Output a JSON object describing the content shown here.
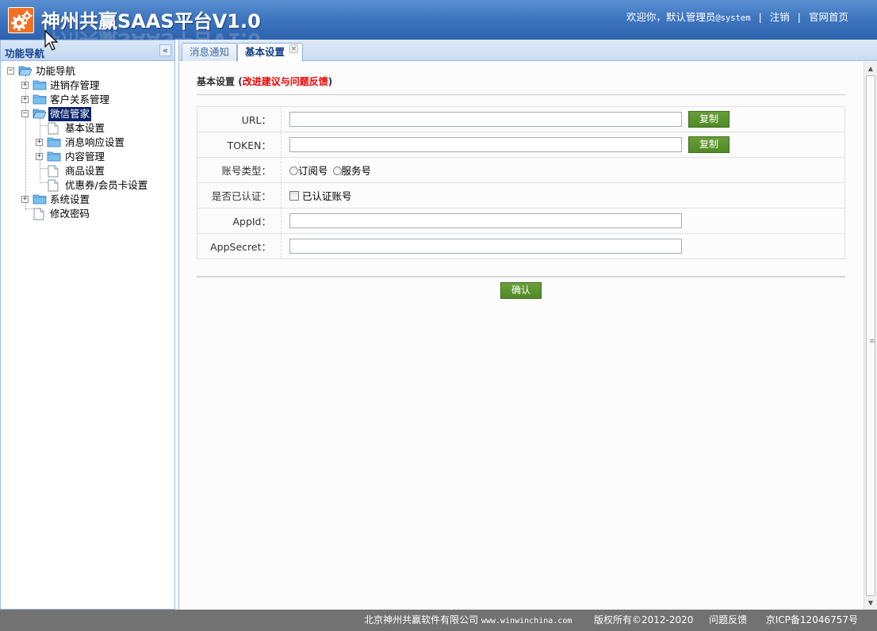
{
  "app": {
    "title": "神州共赢SAAS平台V1.0",
    "welcome_text": "欢迎你，默认管理员",
    "user": "@system",
    "logout_label": "注销",
    "homepage_label": "官网首页",
    "brand_color": "#f37021"
  },
  "sidebar": {
    "title": "功能导航",
    "collapse_glyph": "«",
    "tree": {
      "root": "功能导航",
      "items": [
        {
          "label": "进销存管理"
        },
        {
          "label": "客户关系管理"
        },
        {
          "label": "微信管家",
          "selected": true,
          "children": [
            {
              "label": "基本设置"
            },
            {
              "label": "消息响应设置"
            },
            {
              "label": "内容管理"
            },
            {
              "label": "商品设置"
            },
            {
              "label": "优惠券/会员卡设置"
            }
          ]
        },
        {
          "label": "系统设置"
        },
        {
          "label": "修改密码"
        }
      ]
    }
  },
  "tabs": [
    {
      "label": "消息通知",
      "active": false
    },
    {
      "label": "基本设置",
      "active": true,
      "close_glyph": "×"
    }
  ],
  "main": {
    "section_title": "基本设置",
    "feedback_open": "(",
    "feedback_link": "改进建议与问题反馈",
    "feedback_close": ")",
    "form": {
      "url_label": "URL：",
      "url_value": "",
      "token_label": "TOKEN：",
      "token_value": "",
      "copy_label": "复制",
      "account_type_label": "账号类型：",
      "account_type_options": [
        "订阅号",
        "服务号"
      ],
      "verified_label": "是否已认证：",
      "verified_option": "已认证账号",
      "appid_label": "AppId：",
      "appid_value": "",
      "appsecret_label": "AppSecret：",
      "appsecret_value": ""
    },
    "confirm_label": "确认",
    "button_color": "#5a922e",
    "feedback_color": "#e00000"
  },
  "footer": {
    "company": "北京神州共赢软件有限公司",
    "website": "www.winwinchina.com",
    "copyright": "版权所有©2012-2020",
    "feedback": "问题反馈",
    "icp": "京ICP备12046757号"
  }
}
